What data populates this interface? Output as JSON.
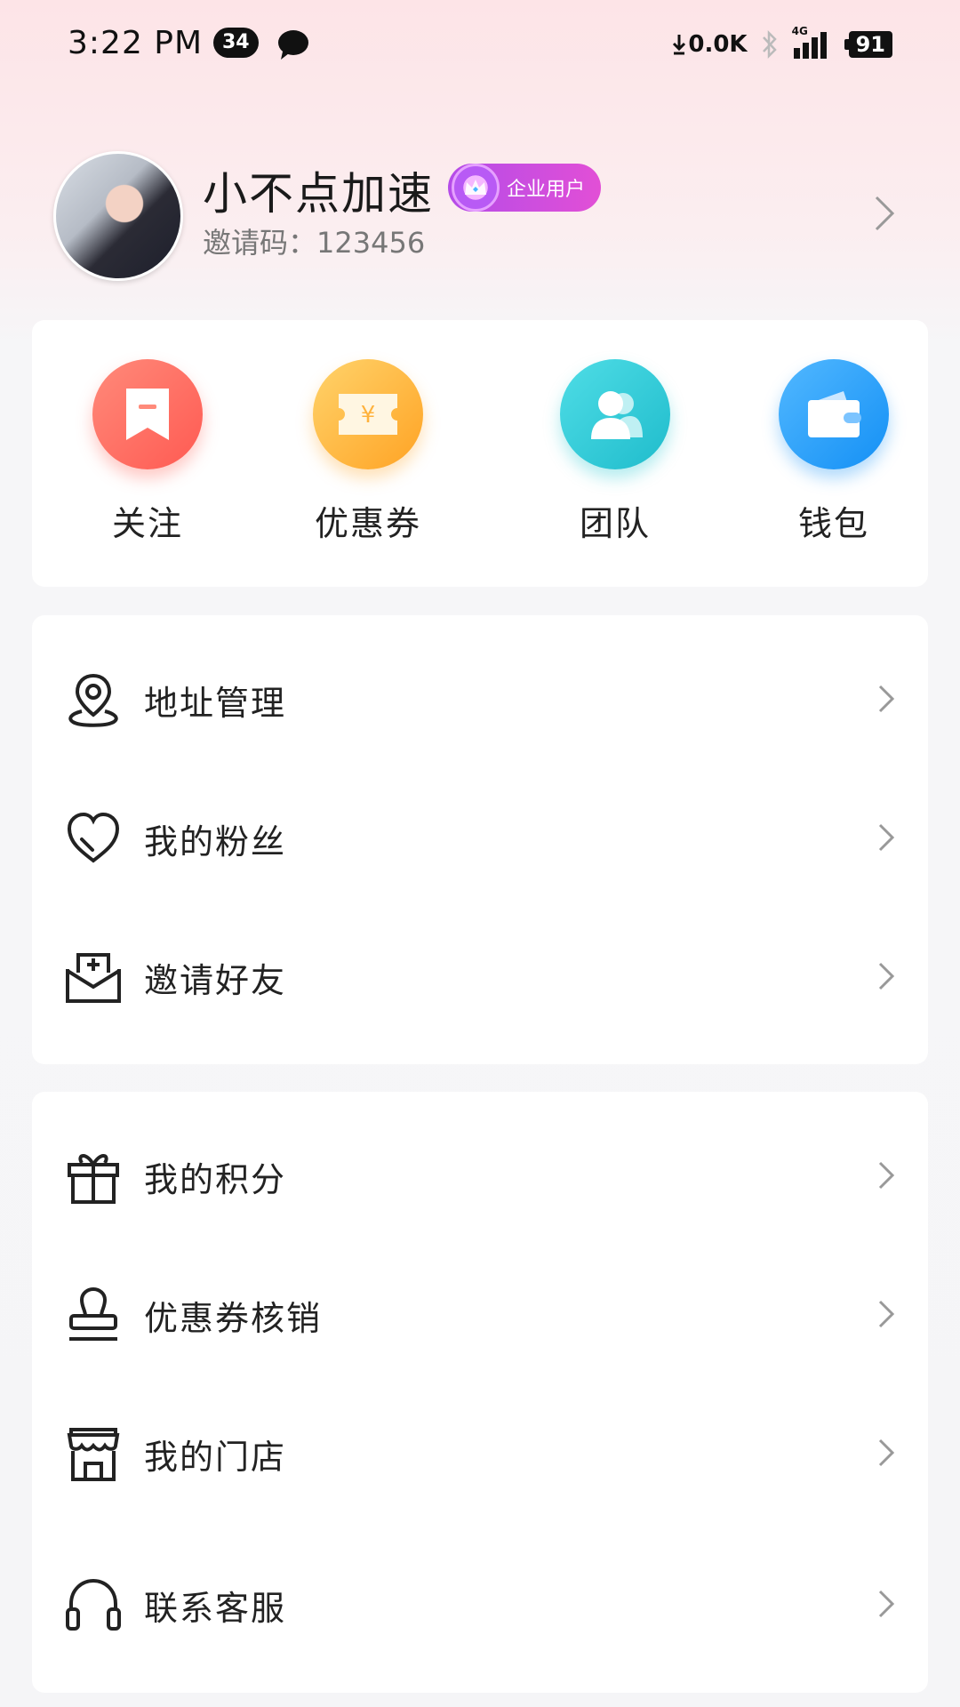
{
  "status_bar": {
    "time": "3:22 PM",
    "notification_count": "34",
    "net_speed": "0.0K",
    "network": "4G",
    "battery": "91"
  },
  "profile": {
    "name": "小不点加速",
    "badge": "企业用户",
    "invite_label": "邀请码：",
    "invite_code": "123456"
  },
  "quick_actions": [
    {
      "label": "关注",
      "icon": "bookmark-icon",
      "color": "#ff6b5f"
    },
    {
      "label": "优惠券",
      "icon": "coupon-icon",
      "color": "#ffb23c"
    },
    {
      "label": "团队",
      "icon": "team-icon",
      "color": "#2fc9d3"
    },
    {
      "label": "钱包",
      "icon": "wallet-icon",
      "color": "#1ea4f9"
    }
  ],
  "menu_group_1": [
    {
      "label": "地址管理",
      "icon": "location-pin-icon"
    },
    {
      "label": "我的粉丝",
      "icon": "heart-icon"
    },
    {
      "label": "邀请好友",
      "icon": "invite-mail-icon"
    }
  ],
  "menu_group_2": [
    {
      "label": "我的积分",
      "icon": "gift-icon"
    },
    {
      "label": "优惠券核销",
      "icon": "stamp-icon"
    },
    {
      "label": "我的门店",
      "icon": "store-icon"
    },
    {
      "label": "联系客服",
      "icon": "headset-icon"
    }
  ]
}
